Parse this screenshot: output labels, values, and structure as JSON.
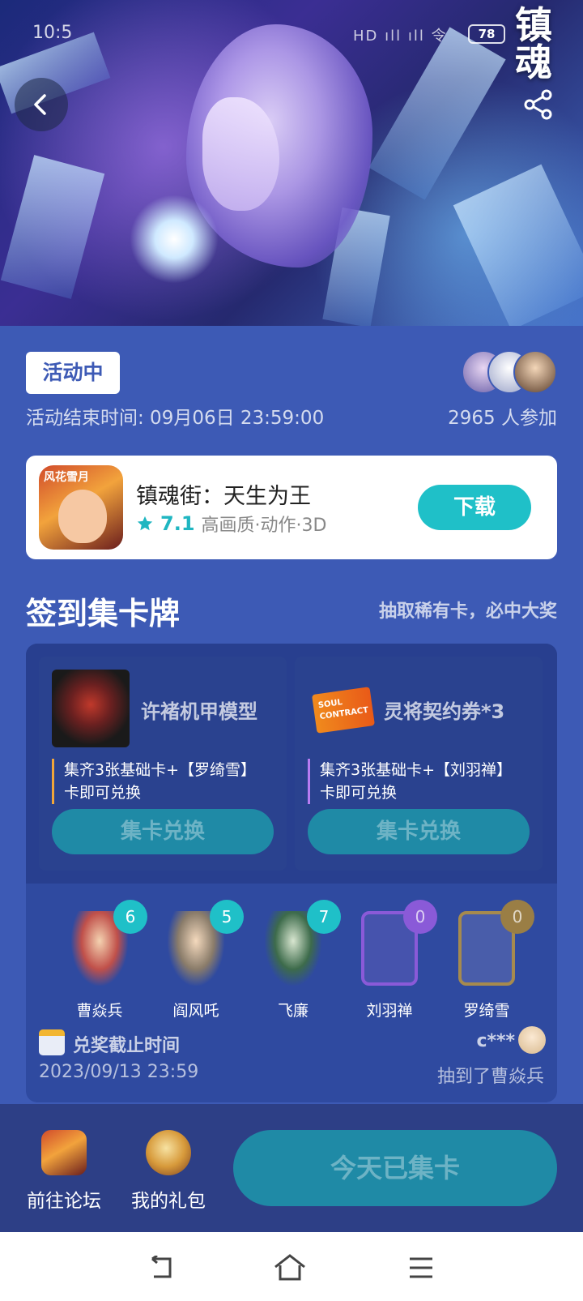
{
  "status_bar": {
    "time": "10:5",
    "icons_text": "HD ıll ıll 令",
    "battery": "78"
  },
  "hero": {
    "logo_text": "镇魂"
  },
  "activity": {
    "status_badge": "活动中",
    "end_time": "活动结束时间: 09月06日 23:59:00",
    "participants": "2965 人参加"
  },
  "game": {
    "icon_text": "风花雪月",
    "title": "镇魂街：天生为王",
    "rating": "7.1",
    "tags": "高画质·动作·3D",
    "download_label": "下载",
    "accent_color": "#1fc0c8"
  },
  "section": {
    "title": "签到集卡牌",
    "subtitle": "抽取稀有卡，必中大奖"
  },
  "rewards": [
    {
      "name": "许褚机甲模型",
      "desc_line1": "集齐3张基础卡+【罗绮雪】",
      "desc_line2": "卡即可兑换",
      "button": "集卡兑换"
    },
    {
      "name": "灵将契约券*3",
      "desc_line1": "集齐3张基础卡+【刘羽禅】",
      "desc_line2": "卡即可兑换",
      "button": "集卡兑换",
      "ticket_text": "SOUL CONTRACT"
    }
  ],
  "cards": [
    {
      "name": "曹焱兵",
      "count": "6"
    },
    {
      "name": "阎风吒",
      "count": "5"
    },
    {
      "name": "飞廉",
      "count": "7"
    },
    {
      "name": "刘羽禅",
      "count": "0"
    },
    {
      "name": "罗绮雪",
      "count": "0"
    }
  ],
  "deadline": {
    "label": "兑奖截止时间",
    "date": "2023/09/13 23:59"
  },
  "winner": {
    "user": "c***",
    "text": "抽到了曹焱兵"
  },
  "bottom_bar": {
    "forum_label": "前往论坛",
    "gift_label": "我的礼包",
    "collected_label": "今天已集卡"
  }
}
